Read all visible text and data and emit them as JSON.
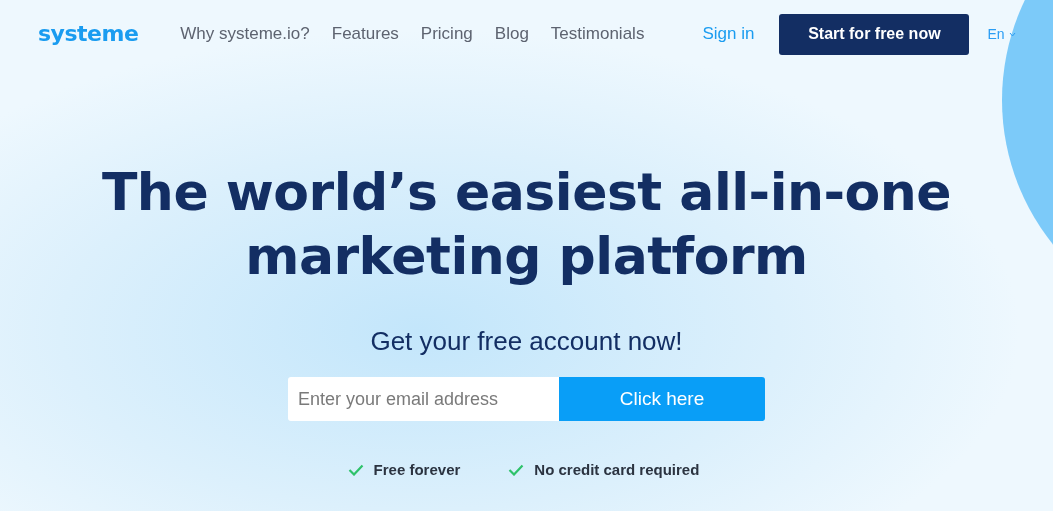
{
  "header": {
    "logo": "systeme",
    "nav": [
      {
        "label": "Why systeme.io?"
      },
      {
        "label": "Features"
      },
      {
        "label": "Pricing"
      },
      {
        "label": "Blog"
      },
      {
        "label": "Testimonials"
      }
    ],
    "sign_in": "Sign in",
    "cta": "Start for free now",
    "language": "En"
  },
  "hero": {
    "heading_lines": [
      "The world’s easiest all-in-one",
      "marketing platform"
    ],
    "subheading": "Get your free account now!",
    "email_field": {
      "placeholder": "Enter your email address"
    },
    "submit": "Click here",
    "features": [
      "Free forever",
      "No credit card required"
    ]
  }
}
